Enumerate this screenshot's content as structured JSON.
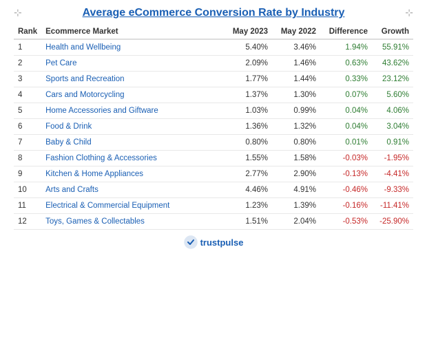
{
  "title": "Average eCommerce Conversion Rate by Industry",
  "table": {
    "headers": [
      "Rank",
      "Ecommerce Market",
      "May 2023",
      "May 2022",
      "Difference",
      "Growth"
    ],
    "rows": [
      {
        "rank": "1",
        "market": "Health and Wellbeing",
        "may2023": "5.40%",
        "may2022": "3.46%",
        "difference": "1.94%",
        "growth": "55.91%",
        "diff_sign": "positive",
        "growth_sign": "positive"
      },
      {
        "rank": "2",
        "market": "Pet Care",
        "may2023": "2.09%",
        "may2022": "1.46%",
        "difference": "0.63%",
        "growth": "43.62%",
        "diff_sign": "positive",
        "growth_sign": "positive"
      },
      {
        "rank": "3",
        "market": "Sports and Recreation",
        "may2023": "1.77%",
        "may2022": "1.44%",
        "difference": "0.33%",
        "growth": "23.12%",
        "diff_sign": "positive",
        "growth_sign": "positive"
      },
      {
        "rank": "4",
        "market": "Cars and Motorcycling",
        "may2023": "1.37%",
        "may2022": "1.30%",
        "difference": "0.07%",
        "growth": "5.60%",
        "diff_sign": "positive",
        "growth_sign": "positive"
      },
      {
        "rank": "5",
        "market": "Home Accessories and Giftware",
        "may2023": "1.03%",
        "may2022": "0.99%",
        "difference": "0.04%",
        "growth": "4.06%",
        "diff_sign": "positive",
        "growth_sign": "positive"
      },
      {
        "rank": "6",
        "market": "Food & Drink",
        "may2023": "1.36%",
        "may2022": "1.32%",
        "difference": "0.04%",
        "growth": "3.04%",
        "diff_sign": "positive",
        "growth_sign": "positive"
      },
      {
        "rank": "7",
        "market": "Baby & Child",
        "may2023": "0.80%",
        "may2022": "0.80%",
        "difference": "0.01%",
        "growth": "0.91%",
        "diff_sign": "positive",
        "growth_sign": "positive"
      },
      {
        "rank": "8",
        "market": "Fashion Clothing & Accessories",
        "may2023": "1.55%",
        "may2022": "1.58%",
        "difference": "-0.03%",
        "growth": "-1.95%",
        "diff_sign": "negative",
        "growth_sign": "negative"
      },
      {
        "rank": "9",
        "market": "Kitchen & Home Appliances",
        "may2023": "2.77%",
        "may2022": "2.90%",
        "difference": "-0.13%",
        "growth": "-4.41%",
        "diff_sign": "negative",
        "growth_sign": "negative"
      },
      {
        "rank": "10",
        "market": "Arts and Crafts",
        "may2023": "4.46%",
        "may2022": "4.91%",
        "difference": "-0.46%",
        "growth": "-9.33%",
        "diff_sign": "negative",
        "growth_sign": "negative"
      },
      {
        "rank": "11",
        "market": "Electrical & Commercial Equipment",
        "may2023": "1.23%",
        "may2022": "1.39%",
        "difference": "-0.16%",
        "growth": "-11.41%",
        "diff_sign": "negative",
        "growth_sign": "negative"
      },
      {
        "rank": "12",
        "market": "Toys, Games & Collectables",
        "may2023": "1.51%",
        "may2022": "2.04%",
        "difference": "-0.53%",
        "growth": "-25.90%",
        "diff_sign": "negative",
        "growth_sign": "negative"
      }
    ]
  },
  "footer": {
    "brand": "trustpulse"
  }
}
